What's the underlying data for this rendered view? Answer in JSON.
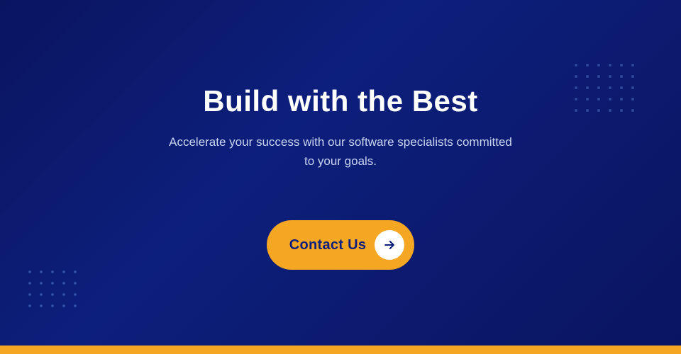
{
  "page": {
    "background_color": "#0a1560",
    "bottom_bar_color": "#f5a623"
  },
  "hero": {
    "title": "Build with the Best",
    "subtitle_line1": "Accelerate your success with our software specialists committed",
    "subtitle_line2": "to your goals.",
    "subtitle": "Accelerate your success with our software specialists committed to your goals."
  },
  "cta": {
    "label": "Contact Us",
    "arrow_icon": "arrow-right-icon"
  }
}
